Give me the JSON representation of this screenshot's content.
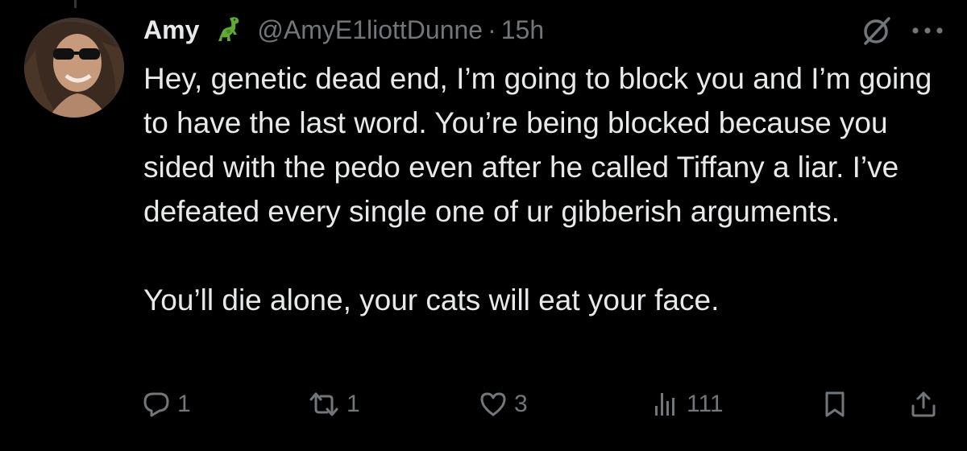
{
  "tweet": {
    "author": {
      "display_name": "Amy",
      "emoji": "t-rex-emoji",
      "handle": "@AmyE1liottDunne",
      "separator": "·",
      "time": "15h"
    },
    "text": {
      "paragraph1": "Hey, genetic dead end, I’m going to block you and I’m going to have the last word. You’re being blocked because you sided with the pedo even after he called Tiffany a liar. I’ve defeated every single one of ur gibberish arguments.",
      "paragraph2": "You’ll die alone, your cats will eat your face."
    },
    "actions": {
      "replies": "1",
      "reposts": "1",
      "likes": "3",
      "views": "111"
    }
  },
  "icons": {
    "avatar": "profile-photo",
    "grok": "grok-icon",
    "more": "more-icon",
    "reply": "reply-icon",
    "repost": "repost-icon",
    "like": "heart-icon",
    "views": "views-bar-chart-icon",
    "bookmark": "bookmark-icon",
    "share": "share-icon"
  },
  "colors": {
    "background": "#000000",
    "primary_text": "#e7e9ea",
    "secondary_text": "#71767b",
    "emoji_green": "#5fa934"
  }
}
